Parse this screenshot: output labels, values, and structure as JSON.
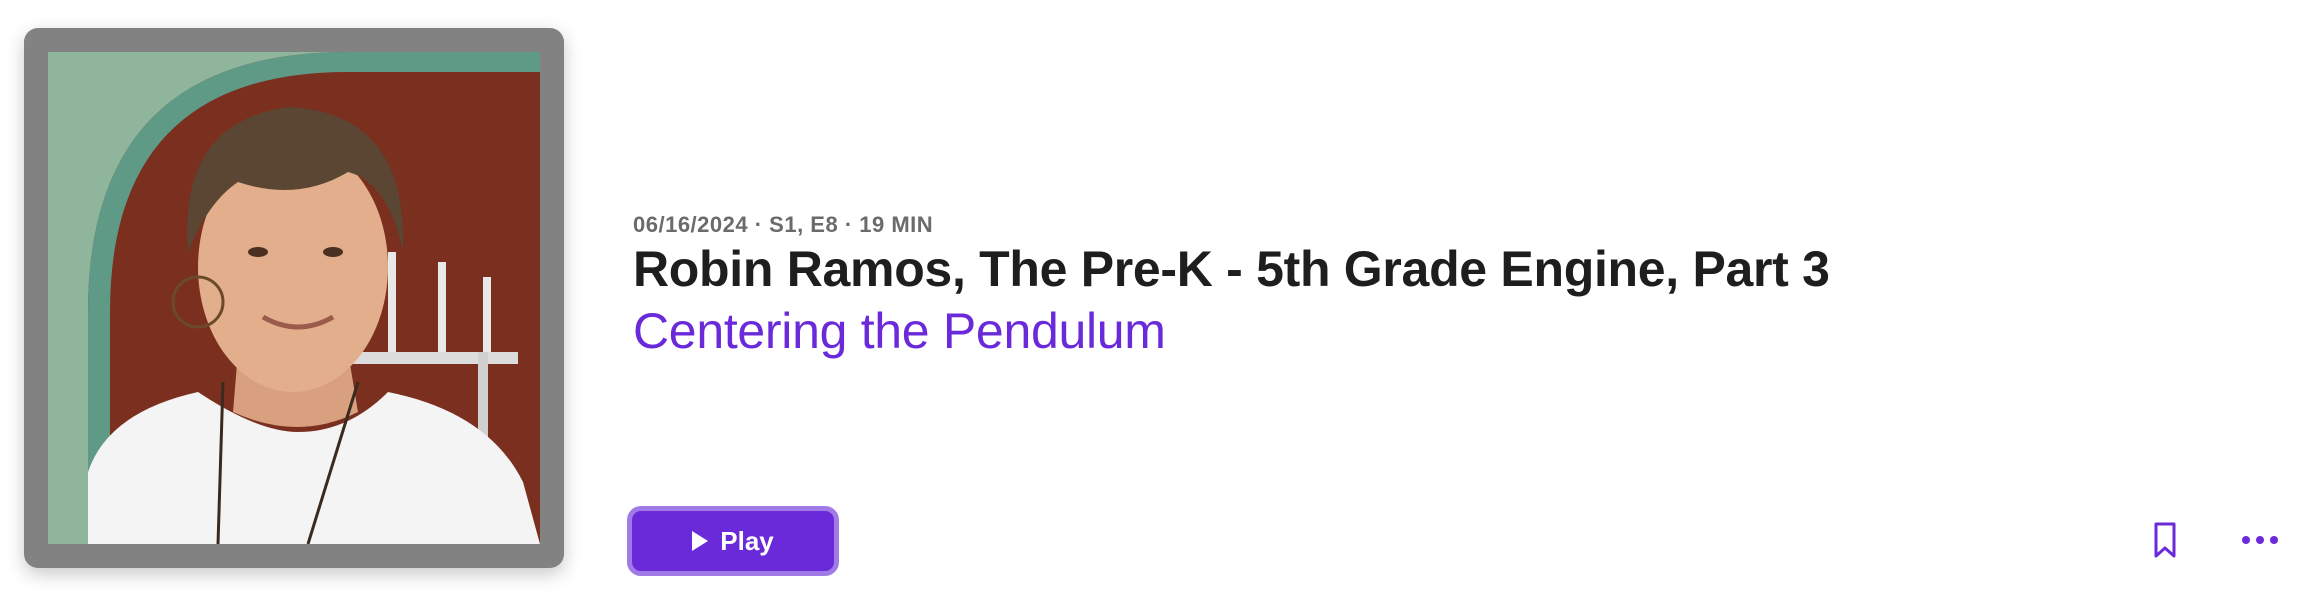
{
  "episode": {
    "meta": "06/16/2024 · S1, E8 · 19 MIN",
    "title": "Robin Ramos, The Pre-K - 5th Grade Engine, Part 3",
    "show_name": "Centering the Pendulum"
  },
  "artwork": {
    "icon": "episode-artwork-portrait"
  },
  "actions": {
    "play_label": "Play",
    "play_icon": "play-icon",
    "bookmark_icon": "bookmark-icon",
    "more_icon": "more-ellipsis-icon"
  },
  "colors": {
    "accent": "#6b2ad9",
    "accent_border": "#a07ae6",
    "title": "#1e1e1e",
    "meta": "#6b6b6b"
  }
}
